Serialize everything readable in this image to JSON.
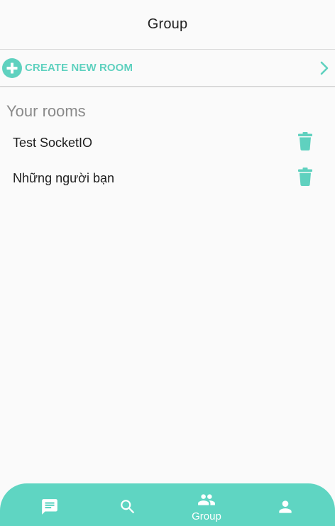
{
  "header": {
    "title": "Group"
  },
  "create_room": {
    "label": "CREATE NEW ROOM",
    "plus_icon": "plus-circle-icon",
    "chevron_icon": "chevron-right-icon"
  },
  "rooms_section": {
    "title": "Your rooms",
    "items": [
      {
        "name": "Test SocketIO",
        "action_icon": "trash-icon"
      },
      {
        "name": "Những người bạn",
        "action_icon": "trash-icon"
      }
    ]
  },
  "bottom_nav": {
    "items": [
      {
        "icon": "chat-icon",
        "label": ""
      },
      {
        "icon": "search-icon",
        "label": ""
      },
      {
        "icon": "group-icon",
        "label": "Group",
        "active": true
      },
      {
        "icon": "person-icon",
        "label": ""
      }
    ]
  },
  "colors": {
    "accent": "#5fd1bf",
    "nav_background": "#5fd5c2",
    "background": "#fafafa",
    "section_title": "#8a8a8a"
  }
}
